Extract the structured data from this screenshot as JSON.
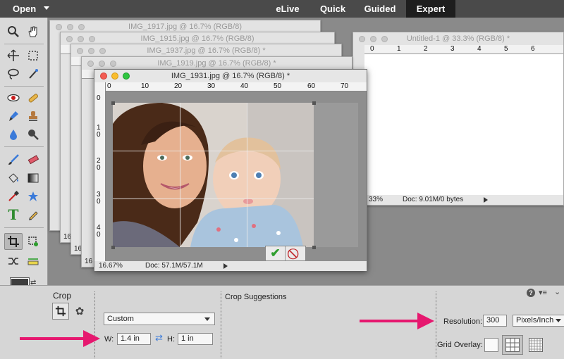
{
  "topbar": {
    "open_label": "Open",
    "tabs": [
      "eLive",
      "Quick",
      "Guided",
      "Expert"
    ],
    "active_tab": "Expert"
  },
  "documents": {
    "stack": [
      "IMG_1917.jpg @ 16.7% (RGB/8)",
      "IMG_1915.jpg @ 16.7% (RGB/8)",
      "IMG_1937.jpg @ 16.7% (RGB/8) *",
      "IMG_1919.jpg @ 16.7% (RGB/8) *"
    ],
    "untitled": {
      "title": "Untitled-1 @ 33.3% (RGB/8) *",
      "ruler": [
        "0",
        "1",
        "2",
        "3",
        "4",
        "5",
        "6"
      ],
      "zoom": "33%",
      "doc_info": "Doc: 9.01M/0 bytes"
    },
    "active": {
      "title": "IMG_1931.jpg @ 16.7% (RGB/8) *",
      "hruler": [
        "0",
        "10",
        "20",
        "30",
        "40",
        "50",
        "60",
        "70"
      ],
      "vruler": [
        "0",
        "1 0",
        "2 0",
        "3 0",
        "4 0"
      ],
      "zoom": "16.67%",
      "doc_info": "Doc: 57.1M/57.1M"
    },
    "partial_zoom_labels": [
      "16",
      "16",
      "16"
    ]
  },
  "options": {
    "tool_name": "Crop",
    "preset": "Custom",
    "width_label": "W:",
    "width_value": "1.4 in",
    "height_label": "H:",
    "height_value": "1 in",
    "suggestions_label": "Crop Suggestions",
    "resolution_label": "Resolution:",
    "resolution_value": "300",
    "resolution_unit": "Pixels/Inch",
    "grid_overlay_label": "Grid Overlay:"
  },
  "colors": {
    "accent_arrow": "#e6186f",
    "commit": "#2e9e2e",
    "cancel": "#c0262a"
  }
}
